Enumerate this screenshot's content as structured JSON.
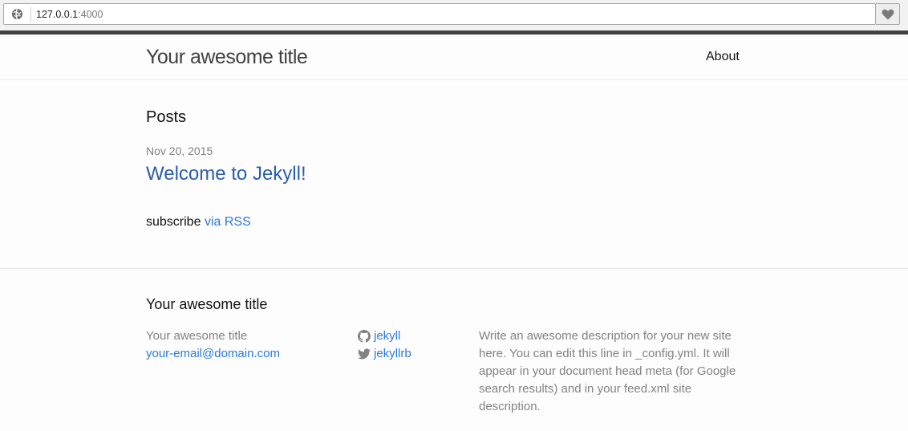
{
  "browser": {
    "url_host": "127.0.0.1",
    "url_port": ":4000"
  },
  "header": {
    "site_title": "Your awesome title",
    "nav": [
      {
        "label": "About"
      }
    ]
  },
  "main": {
    "posts_heading": "Posts",
    "posts": [
      {
        "date": "Nov 20, 2015",
        "title": "Welcome to Jekyll!"
      }
    ],
    "subscribe_text": "subscribe",
    "rss_link": "via RSS"
  },
  "footer": {
    "heading": "Your awesome title",
    "name": "Your awesome title",
    "email": "your-email@domain.com",
    "social": [
      {
        "icon": "github-icon",
        "username": "jekyll"
      },
      {
        "icon": "twitter-icon",
        "username": "jekyllrb"
      }
    ],
    "description": "Write an awesome description for your new site here. You can edit this line in _config.yml. It will appear in your document head meta (for Google search results) and in your feed.xml site description."
  },
  "colors": {
    "link": "#2a7ae2",
    "meta_grey": "#828282",
    "rule_dark": "#424242"
  }
}
